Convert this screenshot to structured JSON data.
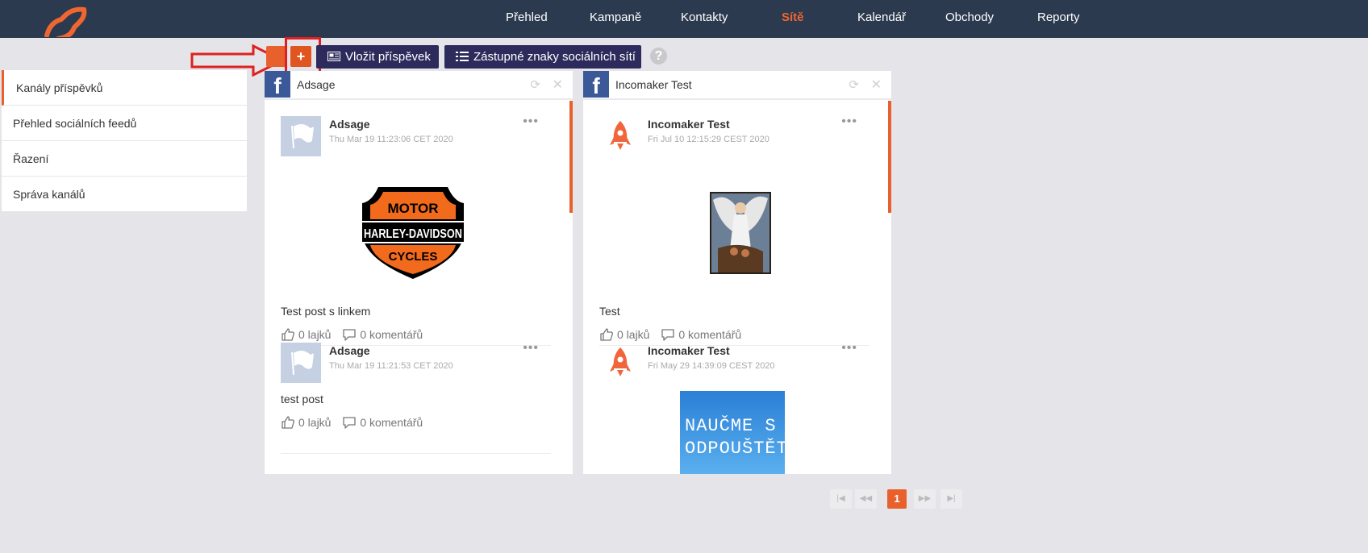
{
  "nav": {
    "items": [
      {
        "label": "Přehled"
      },
      {
        "label": "Kampaně"
      },
      {
        "label": "Kontakty"
      },
      {
        "label": "Sítě"
      },
      {
        "label": "Kalendář"
      },
      {
        "label": "Obchody"
      },
      {
        "label": "Reporty"
      }
    ],
    "active": "Sítě"
  },
  "toolbar": {
    "plus_label": "+",
    "insert_post_label": "Vložit příspěvek",
    "placeholders_label": "Zástupné znaky sociálních sítí",
    "help_label": "?"
  },
  "sidebar": {
    "items": [
      {
        "label": "Kanály příspěvků"
      },
      {
        "label": "Přehled sociálních feedů"
      },
      {
        "label": "Řazení"
      },
      {
        "label": "Správa kanálů"
      }
    ]
  },
  "panels": [
    {
      "title": "Adsage",
      "network": "facebook",
      "posts": [
        {
          "author": "Adsage",
          "date": "Thu Mar 19 11:23:06 CET 2020",
          "image": "harley-davidson-logo",
          "text": "Test post s linkem",
          "likes": "0 lajků",
          "comments": "0 komentářů"
        },
        {
          "author": "Adsage",
          "date": "Thu Mar 19 11:21:53 CET 2020",
          "text": "test post",
          "likes": "0 lajků",
          "comments": "0 komentářů"
        }
      ]
    },
    {
      "title": "Incomaker Test",
      "network": "facebook",
      "posts": [
        {
          "author": "Incomaker Test",
          "date": "Fri Jul 10 12:15:29 CEST 2020",
          "image": "guardian-angel-picture",
          "text": "Test",
          "likes": "0 lajků",
          "comments": "0 komentářů"
        },
        {
          "author": "Incomaker Test",
          "date": "Fri May 29 14:39:09 CEST 2020",
          "image": "naucme-se-odpoustet-picture",
          "image_text": "NAUČME S ODPOUŠTĚT"
        }
      ]
    }
  ],
  "pagination": {
    "first": "|◀",
    "prev": "◀◀",
    "current": "1",
    "next": "▶▶",
    "last": "▶|"
  },
  "colors": {
    "topbar": "#2b3a4f",
    "accent": "#e8612c",
    "dark_button": "#2d2b5c",
    "facebook": "#3b5998"
  }
}
